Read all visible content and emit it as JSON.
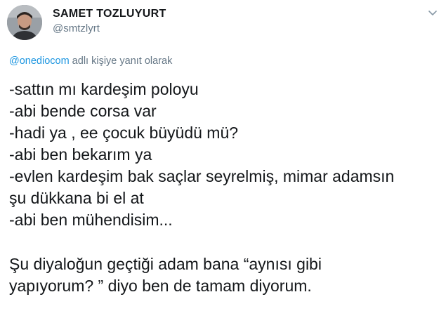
{
  "author": {
    "display_name": "SAMET TOZLUYURT",
    "username": "@smtzlyrt"
  },
  "menu_icon": "chevron-down-icon",
  "reply": {
    "mention": "@onediocom",
    "suffix": " adlı kişiye yanıt olarak"
  },
  "tweet": {
    "dialogue": [
      "-sattın mı kardeşim poloyu",
      "-abi bende corsa var",
      "-hadi ya , ee çocuk büyüdü mü?",
      "-abi ben bekarım ya",
      "-evlen kardeşim bak saçlar seyrelmiş, mimar adamsın",
      "şu dükkana bi el at",
      "-abi ben mühendisim..."
    ],
    "closing": [
      "Şu diyaloğun geçtiği adam bana “aynısı gibi",
      "yapıyorum? ” diyo ben de tamam diyorum."
    ]
  },
  "colors": {
    "text": "#14171a",
    "secondary": "#657786",
    "link": "#1b95e0"
  }
}
